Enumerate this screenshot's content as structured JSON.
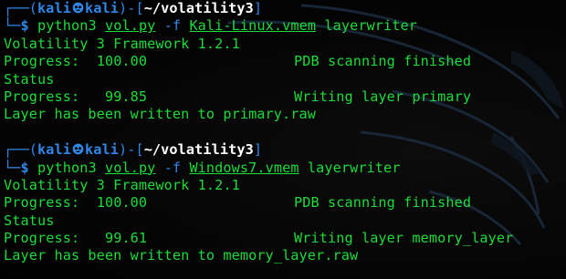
{
  "colors": {
    "green": "#1ddc3a",
    "blue": "#2f87e8",
    "white": "#ffffff",
    "background": "#000000"
  },
  "sessions": [
    {
      "prompt": {
        "frame_top": "┌──(",
        "user": "kali",
        "host": "kali",
        "separator_open": ")-[",
        "cwd": "~/volatility3",
        "separator_close": "]",
        "frame_bottom": "└─",
        "dollar": "$",
        "icon": "kali-skull-icon"
      },
      "command": {
        "program": "python3",
        "script": "vol.py",
        "flag": "-f",
        "file": "Kali-Linux.vmem",
        "plugin": "layerwriter"
      },
      "output": {
        "banner": "Volatility 3 Framework 1.2.1",
        "progress_1_label": "Progress:",
        "progress_1_value": "100.00",
        "progress_1_status": "PDB scanning finished",
        "status_label": "Status",
        "progress_2_label": "Progress:",
        "progress_2_value": " 99.85",
        "progress_2_status": "Writing layer primary",
        "result": "Layer has been written to primary.raw"
      }
    },
    {
      "prompt": {
        "frame_top": "┌──(",
        "user": "kali",
        "host": "kali",
        "separator_open": ")-[",
        "cwd": "~/volatility3",
        "separator_close": "]",
        "frame_bottom": "└─",
        "dollar": "$",
        "icon": "kali-skull-icon"
      },
      "command": {
        "program": "python3",
        "script": "vol.py",
        "flag": "-f",
        "file": "Windows7.vmem",
        "plugin": "layerwriter"
      },
      "output": {
        "banner": "Volatility 3 Framework 1.2.1",
        "progress_1_label": "Progress:",
        "progress_1_value": "100.00",
        "progress_1_status": "PDB scanning finished",
        "status_label": "Status",
        "progress_2_label": "Progress:",
        "progress_2_value": " 99.61",
        "progress_2_status": "Writing layer memory_layer",
        "result": "Layer has been written to memory_layer.raw"
      }
    }
  ]
}
